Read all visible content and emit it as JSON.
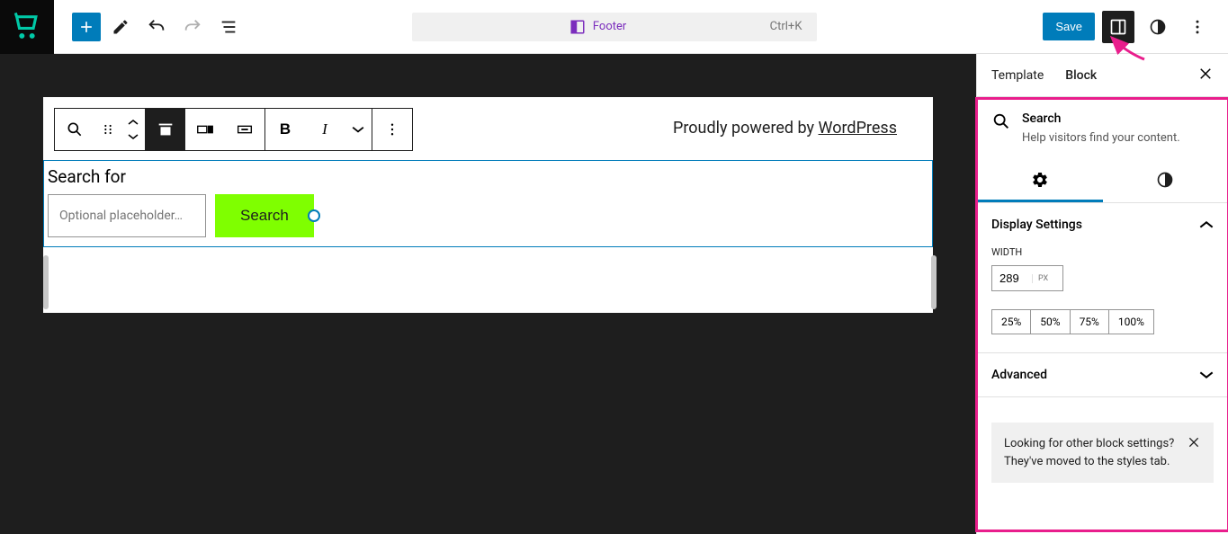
{
  "topbar": {
    "center_label": "Footer",
    "shortcut": "Ctrl+K",
    "save_label": "Save"
  },
  "canvas": {
    "powered_text": "Proudly powered by ",
    "powered_link": "WordPress",
    "search_label": "Search for",
    "search_placeholder": "Optional placeholder…",
    "search_button": "Search"
  },
  "sidebar": {
    "tabs": {
      "template": "Template",
      "block": "Block"
    },
    "block": {
      "title": "Search",
      "desc": "Help visitors find your content."
    },
    "display": {
      "title": "Display Settings",
      "width_label": "Width",
      "width_value": "289",
      "width_unit": "PX",
      "presets": [
        "25%",
        "50%",
        "75%",
        "100%"
      ]
    },
    "advanced": "Advanced",
    "notice": "Looking for other block settings? They've moved to the styles tab."
  }
}
